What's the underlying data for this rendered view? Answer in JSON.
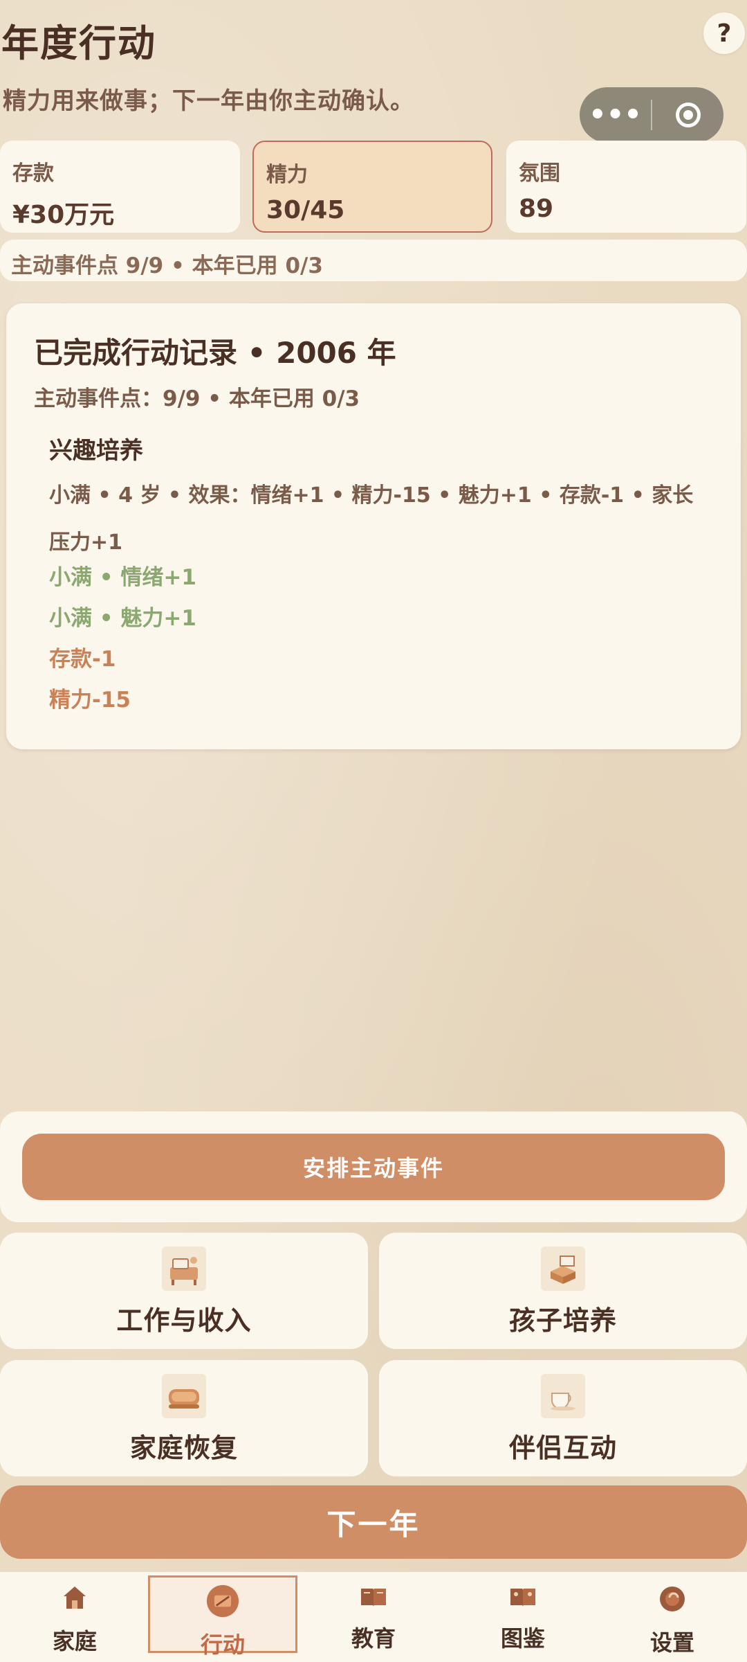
{
  "header": {
    "title": "年度行动",
    "subtitle": "精力用来做事；下一年由你主动确认。",
    "help_label": "?"
  },
  "capsule": {
    "more_label": "•••"
  },
  "stats": [
    {
      "label": "存款",
      "value": "¥30万元"
    },
    {
      "label": "精力",
      "value": "30/45"
    },
    {
      "label": "氛围",
      "value": "89"
    }
  ],
  "points_bar": "主动事件点 9/9 • 本年已用 0/3",
  "record": {
    "title": "已完成行动记录 • 2006 年",
    "subtitle": "主动事件点：9/9 • 本年已用 0/3",
    "event_name": "兴趣培养",
    "event_desc": "小满 • 4 岁 • 效果：情绪+1 • 精力-15 • 魅力+1 • 存款-1 • 家长压力+1",
    "effects": [
      "小满 • 情绪+1",
      "小满 • 魅力+1",
      "存款-1",
      "精力-15"
    ]
  },
  "actions": {
    "arrange_label": "安排主动事件",
    "tiles": [
      {
        "label": "工作与收入",
        "icon": "desk-icon"
      },
      {
        "label": "孩子培养",
        "icon": "book-box-icon"
      },
      {
        "label": "家庭恢复",
        "icon": "bread-icon"
      },
      {
        "label": "伴侣互动",
        "icon": "teacup-icon"
      }
    ],
    "next_year_label": "下一年"
  },
  "tabs": [
    {
      "label": "家庭",
      "icon": "house-icon"
    },
    {
      "label": "行动",
      "icon": "action-icon",
      "active": true
    },
    {
      "label": "教育",
      "icon": "open-book-icon"
    },
    {
      "label": "图鉴",
      "icon": "album-icon"
    },
    {
      "label": "设置",
      "icon": "gear-icon"
    }
  ],
  "colors": {
    "background": "#eadbc3",
    "card": "#fcf7ec",
    "accent": "#d08e66",
    "positive": "#8aa870",
    "negative": "#c98258",
    "text_dark": "#4a3024"
  }
}
